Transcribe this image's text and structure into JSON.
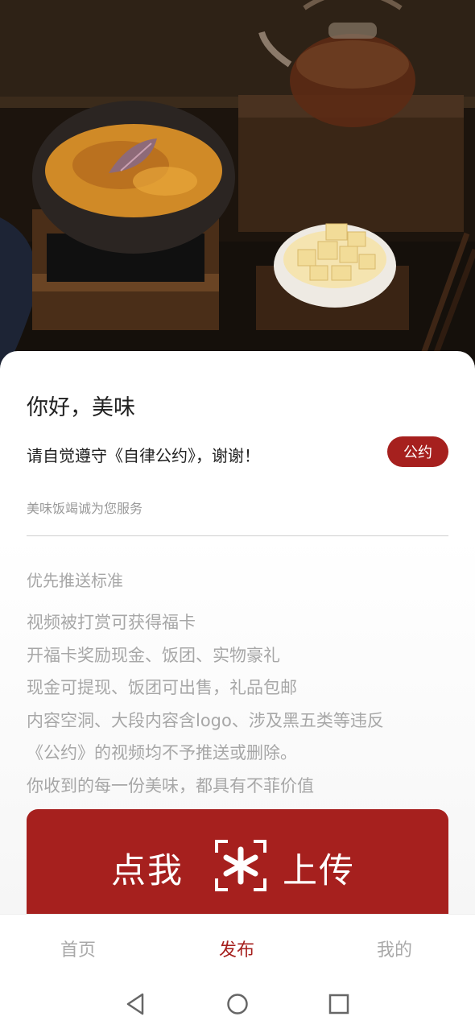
{
  "greeting": "你好，美味",
  "rule_notice": "请自觉遵守《自律公约》，谢谢！",
  "pact_button": "公约",
  "service_text": "美味饭竭诚为您服务",
  "section_title": "优先推送标准",
  "rules": [
    "视频被打赏可获得福卡",
    "开福卡奖励现金、饭团、实物豪礼",
    "现金可提现、饭团可出售，礼品包邮",
    "内容空洞、大段内容含logo、涉及黑五类等违反",
    "《公约》的视频均不予推送或删除。",
    "你收到的每一份美味，都具有不菲价值"
  ],
  "upload": {
    "left_label": "点我",
    "right_label": "上传",
    "icon": "scan-icon"
  },
  "tabs": [
    {
      "label": "首页",
      "active": false
    },
    {
      "label": "发布",
      "active": true
    },
    {
      "label": "我的",
      "active": false
    }
  ],
  "colors": {
    "accent": "#a6201e",
    "muted_text": "#a7a7a7"
  },
  "nav_icons": [
    "back-icon",
    "home-icon",
    "recents-icon"
  ]
}
